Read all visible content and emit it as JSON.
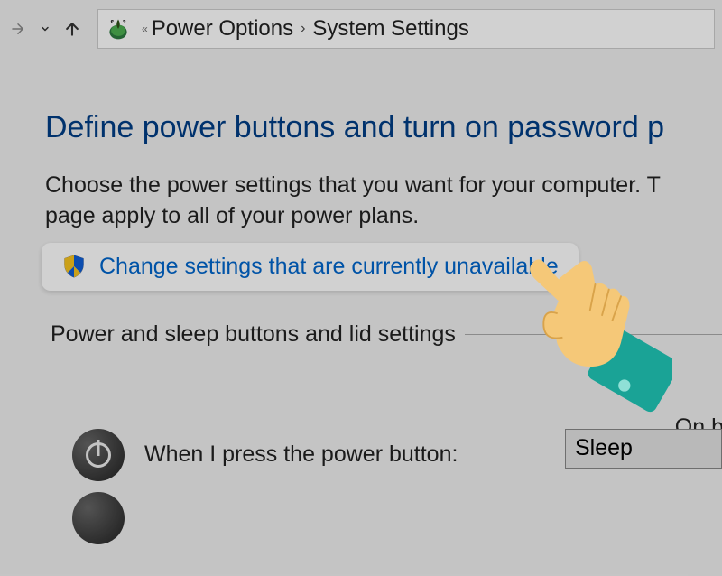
{
  "nav": {
    "breadcrumb_parent": "Power Options",
    "breadcrumb_current": "System Settings"
  },
  "page": {
    "title": "Define power buttons and turn on password p",
    "description_line1": "Choose the power settings that you want for your computer. T",
    "description_line2": "page apply to all of your power plans.",
    "change_link": "Change settings that are currently unavailable",
    "section_heading": "Power and sleep buttons and lid settings",
    "column_on": "On b",
    "power_button_label": "When I press the power button:",
    "power_button_value": "Sleep"
  }
}
